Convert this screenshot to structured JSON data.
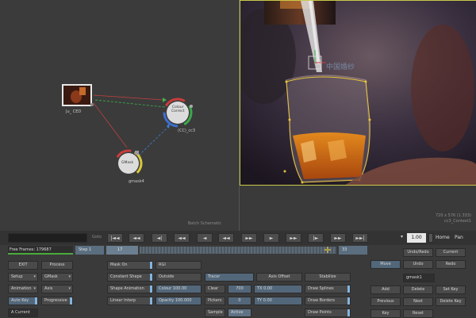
{
  "schematic": {
    "label": "Batch Schematic",
    "nodes": {
      "clip": {
        "label": "Ju_ CED"
      },
      "colour_correct": {
        "title": "Colour\nCorrect",
        "label": "(CC)_cc3"
      },
      "gmask": {
        "title": "GMask",
        "label": "gmask4"
      }
    }
  },
  "viewer": {
    "overlay_text": "中国婚纱",
    "info_line1": "720 x 576 (1.333)",
    "info_line2": "cc3_Context1"
  },
  "transport": {
    "goto_label": "Goto",
    "buttons": [
      "|◄◄",
      "◄◄",
      "◄|",
      "◄◄",
      "◄",
      "◄◄",
      "►►",
      "►",
      "►►",
      "|►",
      "►►",
      "►►|"
    ],
    "zoom_value": "1.00",
    "home_label": "Home",
    "pan_label": "Pan"
  },
  "timeline": {
    "free_frames": "Free Frames: 179687",
    "step": "Step 1",
    "frame": "17",
    "end_frame": "33"
  },
  "controls": {
    "exit": "EXIT",
    "process": "Process",
    "setup": "Setup",
    "gmask": "GMask",
    "animation": "Animation",
    "axis": "Axis",
    "auto_key": "Auto Key",
    "progressive": "Progressive",
    "a_current": "A Current",
    "mask_on": "Mask On",
    "rgi": "RGI",
    "constant_shape": "Constant Shape",
    "outside": "Outside",
    "shape_animation": "Shape Animation",
    "colour": "Colour 100.00",
    "linear_interp": "Linear Interp",
    "opacity": "Opacity 100.000",
    "tracer": "Tracer",
    "axis_offset": "Axis Offset",
    "stabilize": "Stabilize",
    "clear": "Clear",
    "tx": "TX 0.00",
    "draw_splines": "Draw Splines",
    "pickers": "Pickers",
    "ty": "TY 0.00",
    "draw_borders": "Draw Borders",
    "sample": "Sample",
    "active": "Active",
    "draw_points": "Draw Points",
    "val_700": "700",
    "val_0": "0",
    "move": "Move",
    "undo": "Undo",
    "redo": "Redo",
    "undo_redo": "Undo/Redo",
    "current": "Current",
    "gmask_name": "gmask1",
    "add": "Add",
    "delete": "Delete",
    "set_key": "Set Key",
    "previous": "Previous",
    "next": "Next",
    "delete_key": "Delete Key",
    "key": "Key",
    "reset": "Reset"
  }
}
